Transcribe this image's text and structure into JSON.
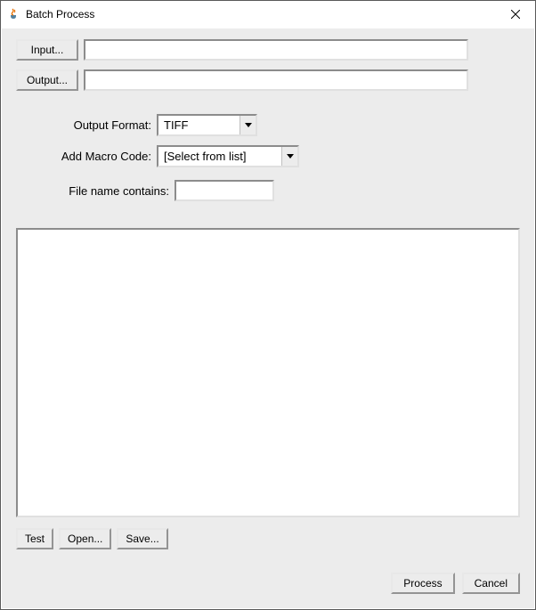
{
  "window": {
    "title": "Batch Process"
  },
  "io": {
    "input_btn": "Input...",
    "input_value": "",
    "output_btn": "Output...",
    "output_value": ""
  },
  "format": {
    "label": "Output Format:",
    "selected": "TIFF"
  },
  "macro": {
    "label": "Add Macro Code:",
    "selected": "[Select from list]"
  },
  "filename": {
    "label": "File name contains:",
    "value": ""
  },
  "script": {
    "value": ""
  },
  "buttons": {
    "test": "Test",
    "open": "Open...",
    "save": "Save...",
    "process": "Process",
    "cancel": "Cancel"
  }
}
